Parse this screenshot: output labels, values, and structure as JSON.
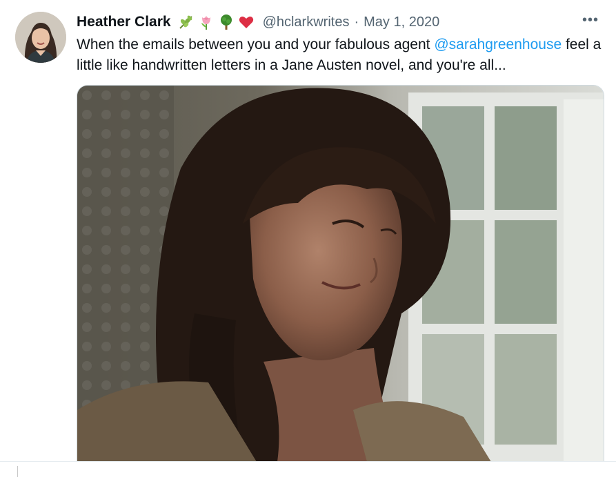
{
  "tweet": {
    "author_name": "Heather Clark",
    "name_emojis": [
      "herb-icon",
      "tulip-icon",
      "tree-icon",
      "heart-icon"
    ],
    "handle": "@hclarkwrites",
    "separator": "·",
    "date": "May 1, 2020",
    "more_label": "•••",
    "text_before": "When the emails between you and your fabulous agent ",
    "mention": "@sarahgreenhouse",
    "text_after": " feel a little like handwritten letters in a Jane Austen novel, and you're all...",
    "media": "gif-woman-smiling-window"
  },
  "colors": {
    "text": "#0f1419",
    "secondary": "#536471",
    "link": "#1d9bf0",
    "border": "#cfd9de"
  }
}
